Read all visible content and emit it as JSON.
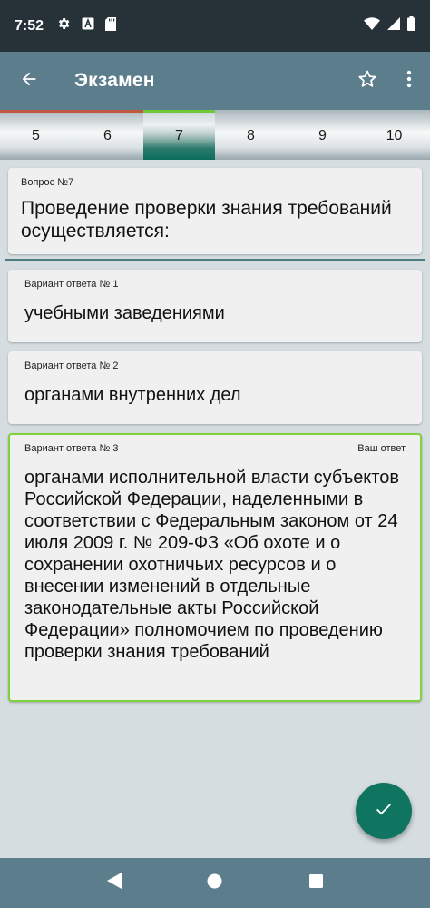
{
  "status_bar": {
    "time": "7:52"
  },
  "app_bar": {
    "title": "Экзамен"
  },
  "tabs": [
    {
      "label": "5",
      "state": "wrong"
    },
    {
      "label": "6",
      "state": "wrong"
    },
    {
      "label": "7",
      "state": "active"
    },
    {
      "label": "8",
      "state": "none"
    },
    {
      "label": "9",
      "state": "none"
    },
    {
      "label": "10",
      "state": "none"
    }
  ],
  "question": {
    "label": "Вопрос №7",
    "text": "Проведение проверки знания требований осуществляется:"
  },
  "answers": [
    {
      "label": "Вариант ответа № 1",
      "text": "учебными заведениями",
      "tag": ""
    },
    {
      "label": "Вариант ответа № 2",
      "text": "органами внутренних дел",
      "tag": ""
    },
    {
      "label": "Вариант ответа № 3",
      "text": "органами исполнительной власти субъектов Российской Федерации, наделенными в соответствии с Федеральным законом от 24 июля 2009 г. № 209-ФЗ «Об охоте и о сохранении охотничьих ресурсов и о внесении изменений в отдельные законодательные акты Российской Федерации» полномочием по проведению проверки знания требований",
      "tag": "Ваш ответ"
    }
  ],
  "colors": {
    "status_bar": "#263238",
    "app_bar": "#5c7d8b",
    "background": "#d5dde1",
    "correct": "#7ed23a",
    "wrong": "#c0573e",
    "fab": "#0f7561"
  },
  "icons": {
    "back": "arrow-left-icon",
    "favorite": "star-outline-icon",
    "menu": "more-vertical-icon",
    "fab": "check-icon"
  }
}
